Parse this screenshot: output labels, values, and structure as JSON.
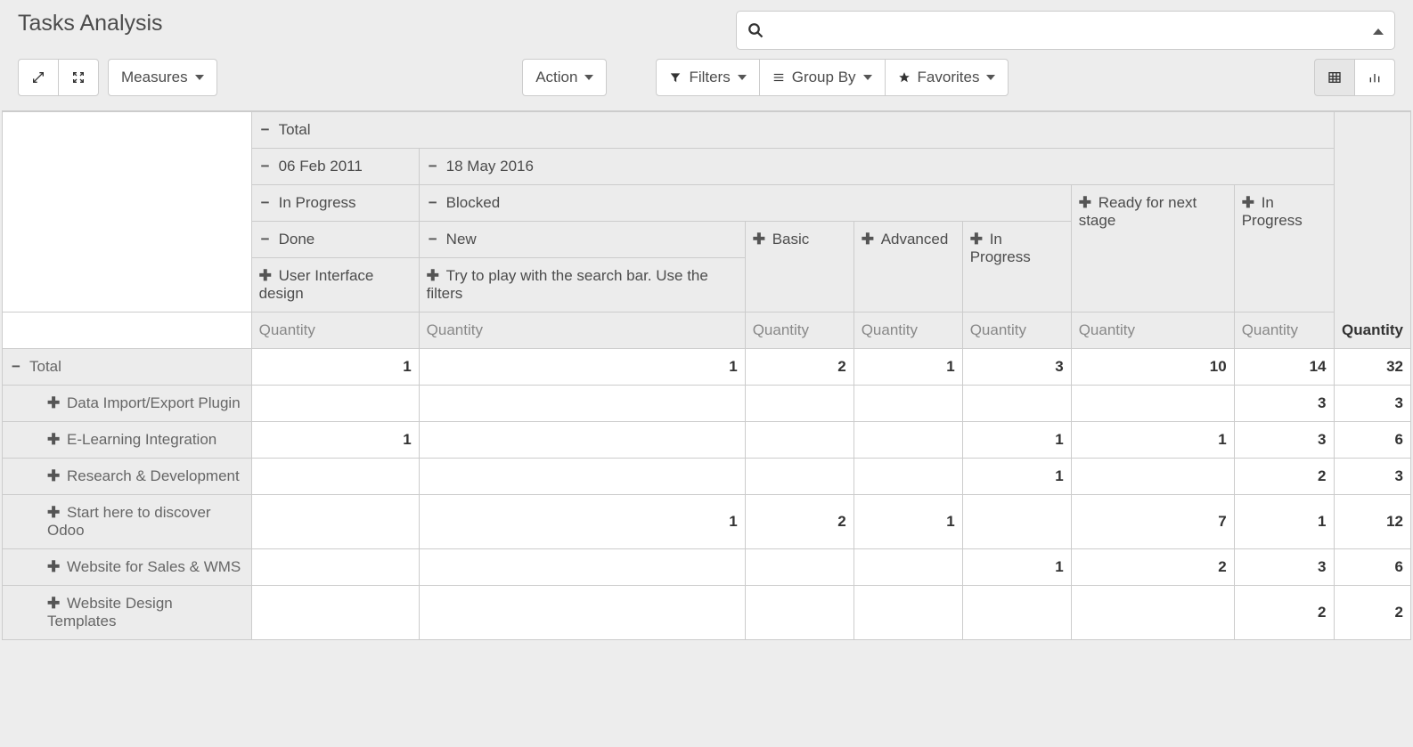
{
  "title": "Tasks Analysis",
  "toolbar": {
    "measures": "Measures",
    "action": "Action",
    "filters": "Filters",
    "group_by": "Group By",
    "favorites": "Favorites"
  },
  "col_headers": {
    "total": "Total",
    "date1": "06 Feb 2011",
    "date2": "18 May 2016",
    "d1_s1": "In Progress",
    "d2_s1": "Blocked",
    "d2_s2": "Ready for next stage",
    "d2_s3": "In Progress",
    "d1_s1_k1": "Done",
    "d2_s1_k1": "New",
    "d2_s1_k2": "Basic",
    "d2_s1_k3": "Advanced",
    "d2_s1_k4": "In Progress",
    "leaf1": "User Interface design",
    "leaf2": "Try to play with the search bar. Use the filters",
    "q": "Quantity",
    "qbold": "Quantity"
  },
  "rows": {
    "total": {
      "label": "Total",
      "v": [
        "1",
        "1",
        "2",
        "1",
        "3",
        "10",
        "14",
        "32"
      ]
    },
    "r1": {
      "label": "Data Import/Export Plugin",
      "v": [
        "",
        "",
        "",
        "",
        "",
        "",
        "3",
        "3"
      ]
    },
    "r2": {
      "label": "E-Learning Integration",
      "v": [
        "1",
        "",
        "",
        "",
        "1",
        "1",
        "3",
        "6"
      ]
    },
    "r3": {
      "label": "Research & Development",
      "v": [
        "",
        "",
        "",
        "",
        "1",
        "",
        "2",
        "3"
      ]
    },
    "r4": {
      "label": "Start here to discover Odoo",
      "v": [
        "",
        "1",
        "2",
        "1",
        "",
        "7",
        "1",
        "12"
      ]
    },
    "r5": {
      "label": "Website for Sales & WMS",
      "v": [
        "",
        "",
        "",
        "",
        "1",
        "2",
        "3",
        "6"
      ]
    },
    "r6": {
      "label": "Website Design Templates",
      "v": [
        "",
        "",
        "",
        "",
        "",
        "",
        "2",
        "2"
      ]
    }
  }
}
